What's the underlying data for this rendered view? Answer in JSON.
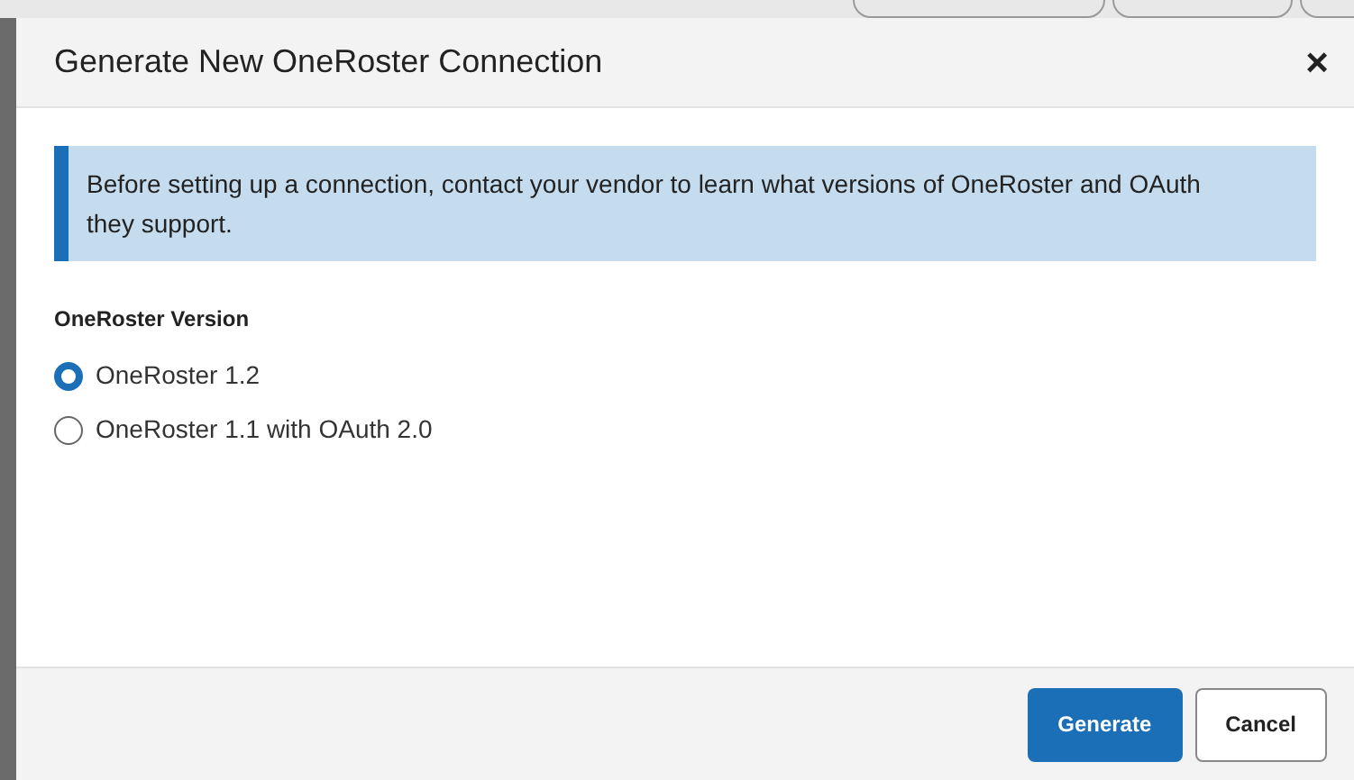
{
  "dialog": {
    "title": "Generate New OneRoster Connection",
    "close": "×"
  },
  "notice": "Before setting up a connection, contact your vendor to learn what versions of OneRoster and OAuth they support.",
  "version_group": {
    "label": "OneRoster Version",
    "options": [
      {
        "label": "OneRoster 1.2",
        "selected": true
      },
      {
        "label": "OneRoster 1.1 with OAuth 2.0",
        "selected": false
      }
    ]
  },
  "buttons": [
    {
      "label": "Generate",
      "kind": "primary"
    },
    {
      "label": "Cancel",
      "kind": "secondary"
    }
  ]
}
